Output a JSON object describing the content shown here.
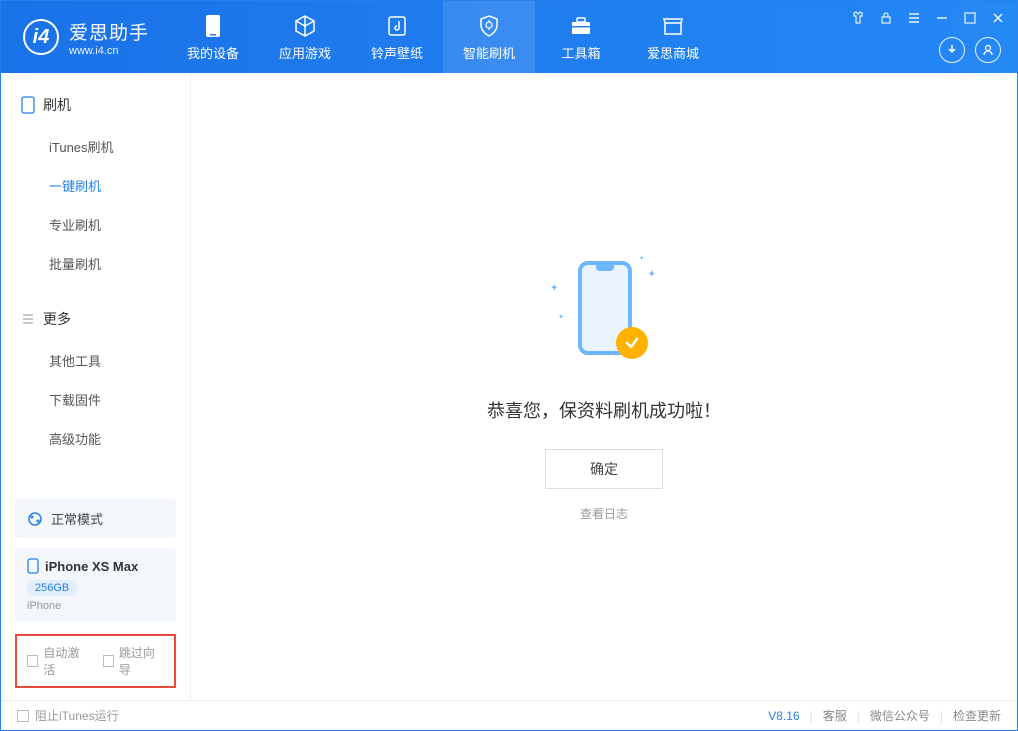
{
  "app": {
    "title": "爱思助手",
    "subtitle": "www.i4.cn"
  },
  "tabs": [
    {
      "label": "我的设备"
    },
    {
      "label": "应用游戏"
    },
    {
      "label": "铃声壁纸"
    },
    {
      "label": "智能刷机"
    },
    {
      "label": "工具箱"
    },
    {
      "label": "爱思商城"
    }
  ],
  "sidebar": {
    "section1": {
      "title": "刷机",
      "items": [
        "iTunes刷机",
        "一键刷机",
        "专业刷机",
        "批量刷机"
      ]
    },
    "section2": {
      "title": "更多",
      "items": [
        "其他工具",
        "下载固件",
        "高级功能"
      ]
    },
    "mode": "正常模式",
    "device": {
      "name": "iPhone XS Max",
      "capacity": "256GB",
      "type": "iPhone"
    },
    "checkboxes": {
      "autoActivate": "自动激活",
      "skipGuide": "跳过向导"
    }
  },
  "main": {
    "success": "恭喜您，保资料刷机成功啦！",
    "okButton": "确定",
    "logLink": "查看日志"
  },
  "footer": {
    "blockItunes": "阻止iTunes运行",
    "version": "V8.16",
    "support": "客服",
    "wechat": "微信公众号",
    "update": "检查更新"
  }
}
